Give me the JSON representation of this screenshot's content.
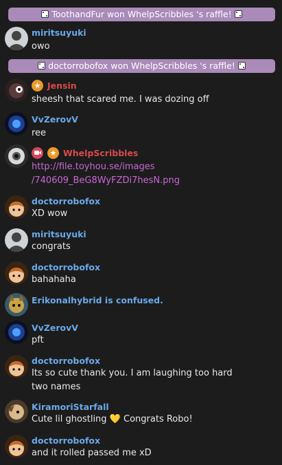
{
  "raffles": [
    {
      "text": "ToothandFur won WhelpScribbles 's raffle!"
    },
    {
      "text": "doctorrobofox won WhelpScribbles 's raffle!"
    }
  ],
  "messages": [
    {
      "user": "miritsuyuki",
      "lines": [
        "owo"
      ],
      "avatar": "grey-figure"
    },
    {
      "user": "Jensin",
      "lines": [
        "sheesh that scared me. I was dozing off"
      ],
      "avatar": "dark-creature",
      "badges": [
        "star-badge"
      ]
    },
    {
      "user": "VvZerovV",
      "lines": [
        "ree"
      ],
      "avatar": "blue-orb"
    },
    {
      "user": "WhelpScribbles",
      "lines": [
        "http://file.toyhou.se/images",
        "/740609_BeG8WyFZDi7hesN.png"
      ],
      "avatar": "eye-creature",
      "badges": [
        "camera-badge",
        "star-badge"
      ]
    },
    {
      "user": "doctorrobofox",
      "lines": [
        "XD wow"
      ],
      "avatar": "fox-girl"
    },
    {
      "user": "miritsuyuki",
      "lines": [
        "congrats"
      ],
      "avatar": "grey-figure"
    },
    {
      "user": "doctorrobofox",
      "lines": [
        "bahahaha"
      ],
      "avatar": "fox-girl"
    },
    {
      "user": "Erikonalhybrid is confused.",
      "lines": [],
      "avatar": "golden-creature"
    },
    {
      "user": "VvZerovV",
      "lines": [
        "pft"
      ],
      "avatar": "blue-orb"
    },
    {
      "user": "doctorrobofox",
      "lines": [
        "Its so cute thank you. I am laughing too hard",
        "two names"
      ],
      "avatar": "fox-girl"
    },
    {
      "user": "KiramoriStarfall",
      "lines": [
        "Cute lil ghostling",
        "Congrats Robo!"
      ],
      "avatar": "tan-creature"
    },
    {
      "user": "doctorrobofox",
      "lines": [
        "and it rolled passed me xD"
      ],
      "avatar": "fox-girl"
    }
  ],
  "colors": {
    "background": "#1c1c1c",
    "raffle_banner": "#a98ab9",
    "username": "#6aa9e8",
    "mod_username": "#d84a4a",
    "link": "#c968d6"
  }
}
